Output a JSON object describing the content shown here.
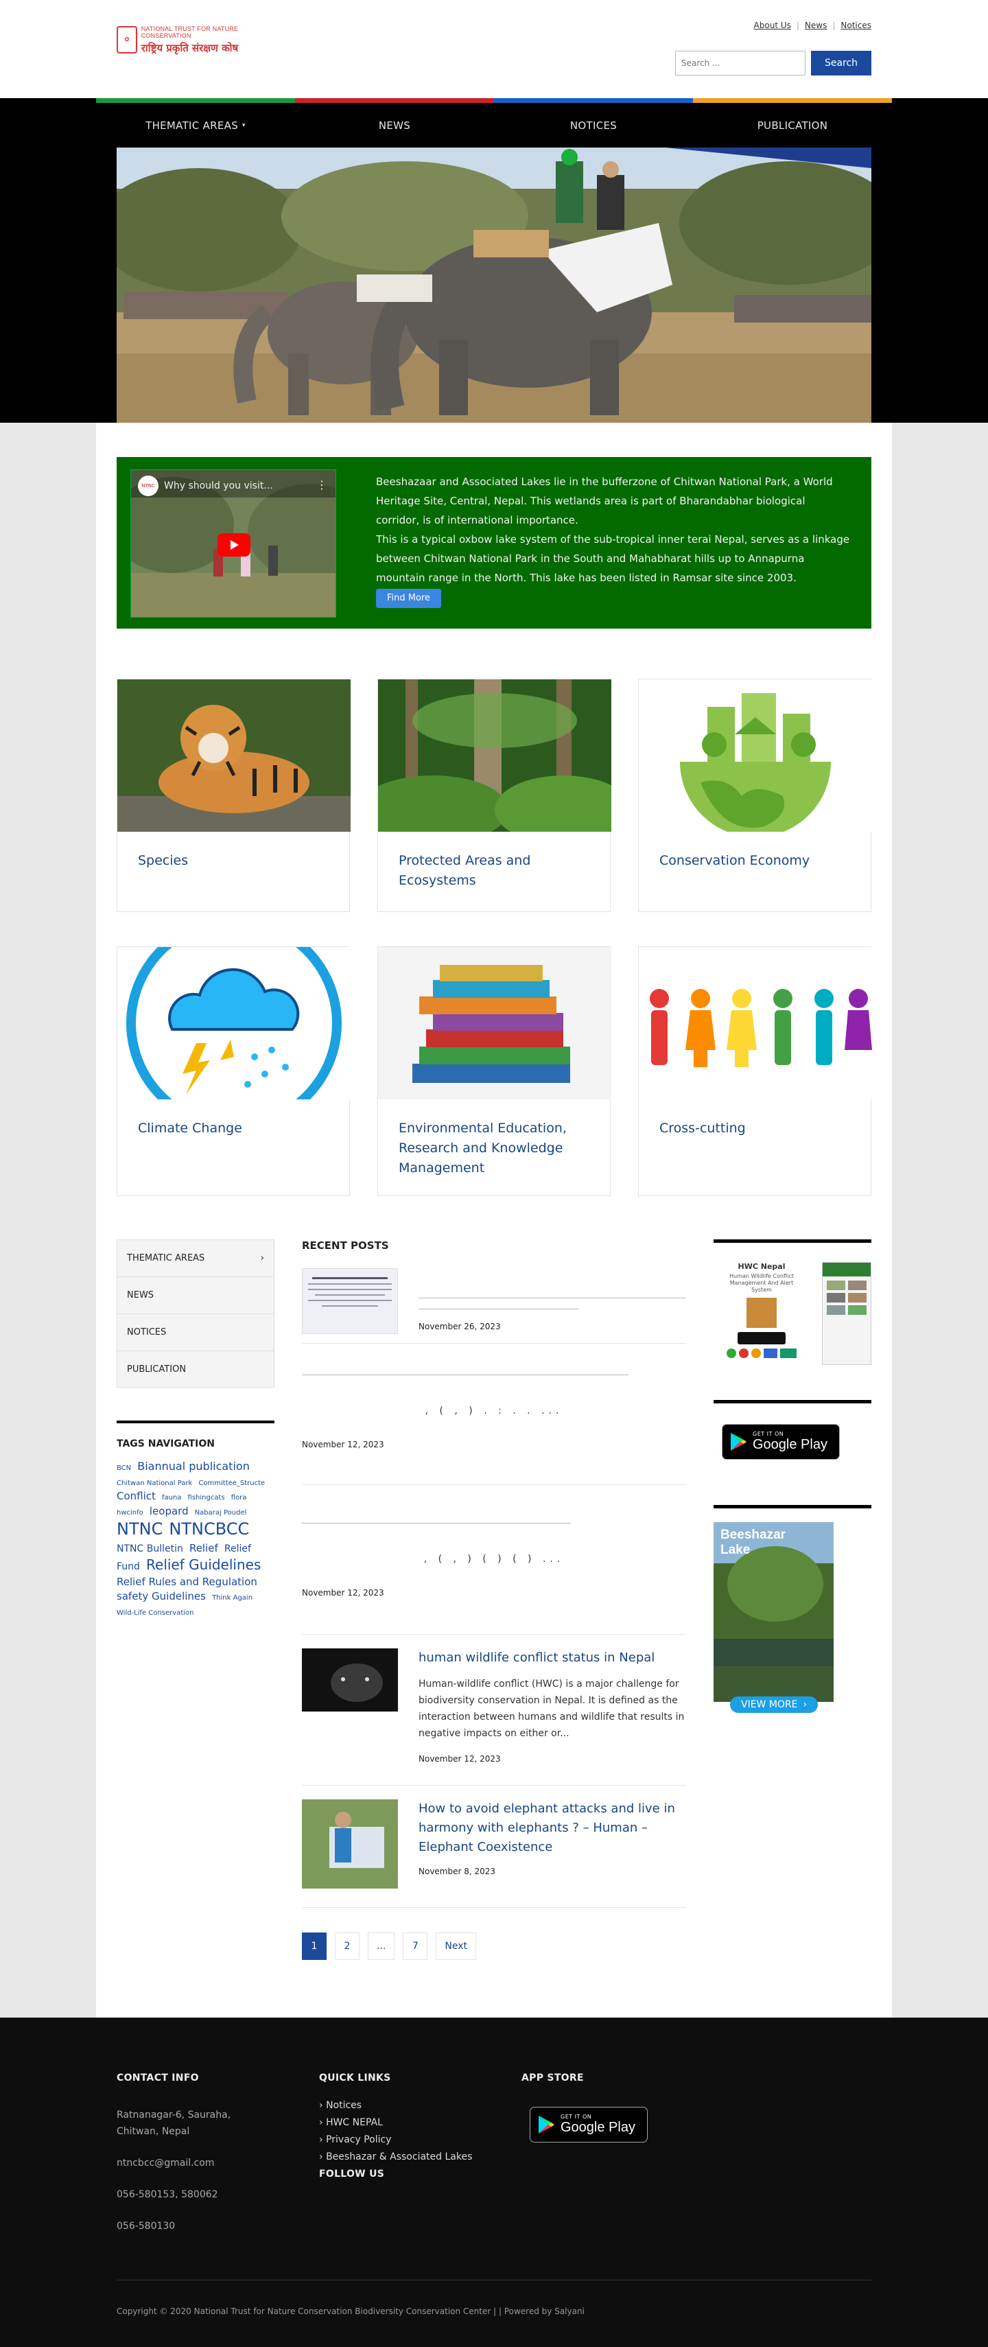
{
  "header": {
    "logo_line1": "NATIONAL TRUST FOR NATURE CONSERVATION",
    "logo_line2": "राष्ट्रिय प्रकृति संरक्षण कोष",
    "toplinks": [
      "About Us",
      "News",
      "Notices"
    ],
    "search_placeholder": "Search ...",
    "search_button": "Search"
  },
  "nav": {
    "items": [
      {
        "label": "THEMATIC AREAS",
        "color": "#1a9a3a"
      },
      {
        "label": "NEWS",
        "color": "#c9232b"
      },
      {
        "label": "NOTICES",
        "color": "#1c5fc6"
      },
      {
        "label": "PUBLICATION",
        "color": "#f0a21a"
      }
    ]
  },
  "intro": {
    "video_title": "Why should you visit...",
    "video_channel": "NTNC",
    "para1": "Beeshazaar and Associated Lakes lie in the bufferzone of Chitwan National Park, a World Heritage Site, Central, Nepal. This wetlands area is part of Bharandabhar biological corridor, is of international importance.",
    "para2": "This is a typical oxbow lake system of the sub-tropical inner terai Nepal, serves as a linkage between Chitwan National Park in the South and Mahabharat hills up to Annapurna mountain range in the North. This lake has been listed in Ramsar site since 2003.",
    "button": "Find More"
  },
  "cards": [
    {
      "title": "Species"
    },
    {
      "title": "Protected Areas and Ecosystems"
    },
    {
      "title": "Conservation Economy"
    },
    {
      "title": "Climate Change"
    },
    {
      "title": "Environmental Education, Research and Knowledge Management"
    },
    {
      "title": "Cross-cutting"
    }
  ],
  "sidebar": {
    "items": [
      "THEMATIC AREAS",
      "NEWS",
      "NOTICES",
      "PUBLICATION"
    ],
    "tags_title": "TAGS NAVIGATION",
    "tags": [
      {
        "t": "BCN",
        "s": 10
      },
      {
        "t": "Biannual publication",
        "s": 16
      },
      {
        "t": "Chitwan National Park",
        "s": 10
      },
      {
        "t": "Committee_Structe",
        "s": 10
      },
      {
        "t": "Conflict",
        "s": 15
      },
      {
        "t": "fauna",
        "s": 10
      },
      {
        "t": "fishingcats",
        "s": 10
      },
      {
        "t": "flora",
        "s": 10
      },
      {
        "t": "hwcinfo",
        "s": 10
      },
      {
        "t": "leopard",
        "s": 15
      },
      {
        "t": "Nabaraj Poudel",
        "s": 10
      },
      {
        "t": "NTNC",
        "s": 24
      },
      {
        "t": "NTNCBCC",
        "s": 24
      },
      {
        "t": "NTNC Bulletin",
        "s": 14
      },
      {
        "t": "Relief",
        "s": 15
      },
      {
        "t": "Relief Fund",
        "s": 14
      },
      {
        "t": "Relief Guidelines",
        "s": 20
      },
      {
        "t": "Relief Rules and Regulation",
        "s": 15
      },
      {
        "t": "safety Guidelines",
        "s": 15
      },
      {
        "t": "Think Again",
        "s": 10
      },
      {
        "t": "Wild-Life Conservation",
        "s": 10
      }
    ]
  },
  "posts": {
    "heading": "RECENT POSTS",
    "items": [
      {
        "title": "",
        "date": "November 26, 2023",
        "excerpt": ""
      },
      {
        "title": "",
        "date": "November 12, 2023",
        "excerpt": ", ( , ) . : . . ..."
      },
      {
        "title": "",
        "date": "November 12, 2023",
        "excerpt": ", ( , ) ( ) ( ) ..."
      },
      {
        "title": "human wildlife conflict status in Nepal",
        "date": "November 12, 2023",
        "excerpt": "Human-wildlife conflict (HWC) is a major challenge for biodiversity conservation in Nepal. It is defined as the interaction between humans and wildlife that results in negative impacts on either or..."
      },
      {
        "title": "How to avoid elephant attacks and live in harmony with elephants ? – Human – Elephant Coexistence",
        "date": "November 8, 2023",
        "excerpt": ""
      }
    ],
    "pages": [
      "1",
      "2",
      "...",
      "7",
      "Next"
    ]
  },
  "right": {
    "app_title": "HWC Nepal",
    "app_sub": "Human Wildlife Conflict Management And Alert System",
    "gp_small": "GET IT ON",
    "gp_big": "Google Play",
    "lake_title": "Beeshazar Lake",
    "lake_button": "VIEW MORE"
  },
  "footer": {
    "contact_title": "CONTACT INFO",
    "address": "Ratnanagar-6, Sauraha, Chitwan, Nepal",
    "email": "ntncbcc@gmail.com",
    "phone1": "056-580153, 580062",
    "phone2": "056-580130",
    "links_title": "QUICK LINKS",
    "links": [
      "Notices",
      "HWC NEPAL",
      "Privacy Policy",
      "Beeshazar & Associated Lakes"
    ],
    "follow": "FOLLOW US",
    "app_title": "APP STORE",
    "copyright": "Copyright © 2020 National Trust for Nature Conservation Biodiversity Conservation Center | | Powered by Salyani"
  }
}
